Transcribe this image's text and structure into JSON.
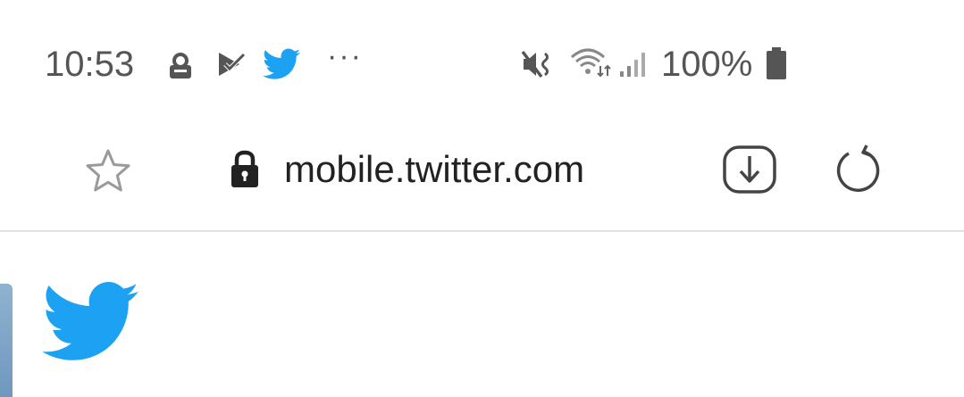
{
  "status_bar": {
    "time": "10:53",
    "notification_icons": [
      "account-lock-icon",
      "tasks-check-icon",
      "twitter-bird-icon"
    ],
    "more_indicator": "···",
    "system_icons": [
      "vibrate-mute-icon",
      "wifi-icon",
      "signal-icon",
      "battery-icon"
    ],
    "battery_percent": "100%"
  },
  "browser": {
    "url": "mobile.twitter.com",
    "bookmark_icon": "star-icon",
    "secure_icon": "lock-icon",
    "download_icon": "download-icon",
    "reload_icon": "reload-icon"
  },
  "page": {
    "logo_icon": "twitter-bird-icon"
  },
  "colors": {
    "twitter_blue": "#1DA1F2",
    "status_gray": "#555555",
    "icon_gray": "#9a9a9a",
    "text_dark": "#222222",
    "divider": "#e2e2e2"
  }
}
